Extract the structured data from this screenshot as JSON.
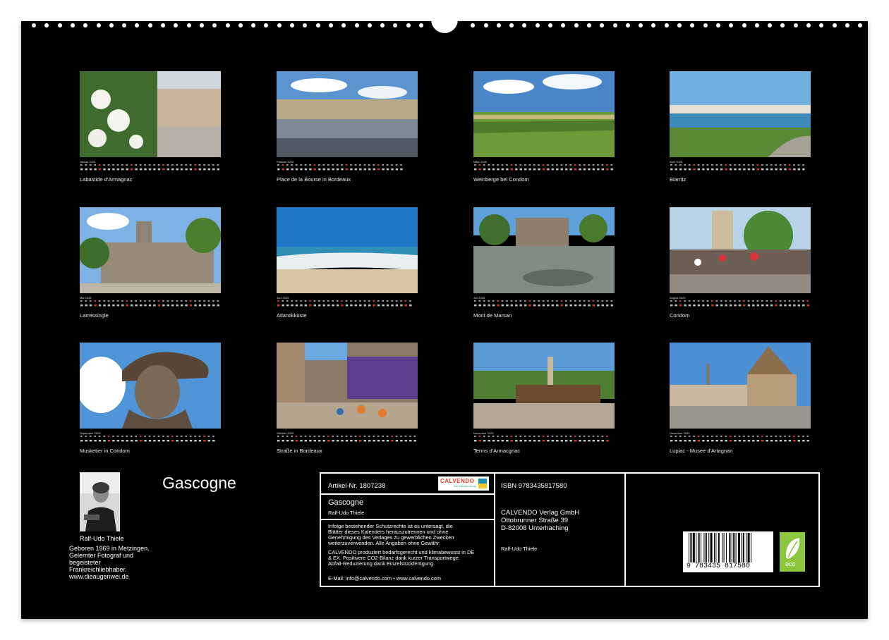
{
  "months": [
    {
      "month": "Januar 2025",
      "caption": "Labastide d'Armagnac"
    },
    {
      "month": "Februar 2025",
      "caption": "Place de la Bourse in Bordeaux"
    },
    {
      "month": "März 2025",
      "caption": "Weinberge bei Condom"
    },
    {
      "month": "April 2025",
      "caption": "Biarritz"
    },
    {
      "month": "Mai 2025",
      "caption": "Larressingle"
    },
    {
      "month": "Juni 2025",
      "caption": "Atlantikküste"
    },
    {
      "month": "Juli 2025",
      "caption": "Mont de Marsan"
    },
    {
      "month": "August 2025",
      "caption": "Condom"
    },
    {
      "month": "September 2025",
      "caption": "Musketier in Condom"
    },
    {
      "month": "Oktober 2025",
      "caption": "Straße in Bordeaux"
    },
    {
      "month": "November 2025",
      "caption": "Terms d'Armacgnac"
    },
    {
      "month": "Dezember 2025",
      "caption": "Lupiac - Musee d'Artagnan"
    }
  ],
  "title": "Gascogne",
  "author": {
    "name": "Ralf-Udo Thiele",
    "bio": [
      "Geboren 1969 in Metzingen.",
      "Gelernter Fotograf und",
      "begeisteter",
      "Frankreichliebhaber.",
      "www.dieaugenwei.de"
    ]
  },
  "info": {
    "article": "Artikel-Nr. 1807238",
    "logo": "CALVENDO",
    "logo_sub": "Ihre Kalender-verlag",
    "title": "Gascogne",
    "author": "Ralf-Udo Thiele",
    "legal": [
      "Infolge bestehender Schutzrechte ist es untersagt, die",
      "Blätter dieses Kalenders herauszutrennen und ohne",
      "Genehmigung des Verlages zu gewerblichen Zwecken",
      "weiterzuverwenden. Alle Angaben ohne Gewähr."
    ],
    "eco_text": [
      "CALVENDO produziert bedarfsgerecht und klimabewusst in DE",
      "& EX. Positivere CO2-Bilanz dank kurzer Transportwege.",
      "Abfall-Reduzierung dank Einzelstückfertigung."
    ],
    "contact": "E-Mail: info@calvendo.com • www.calvendo.com",
    "isbn": "ISBN 9783435817580",
    "publisher": [
      "CALVENDO Verlag GmbH",
      "Ottobrunner Straße 39",
      "D-82008 Unterhaching"
    ],
    "publisher_author": "Ralf-Udo Thiele",
    "barcode_digits": "9 783435 817580",
    "eco_label": "eco"
  }
}
